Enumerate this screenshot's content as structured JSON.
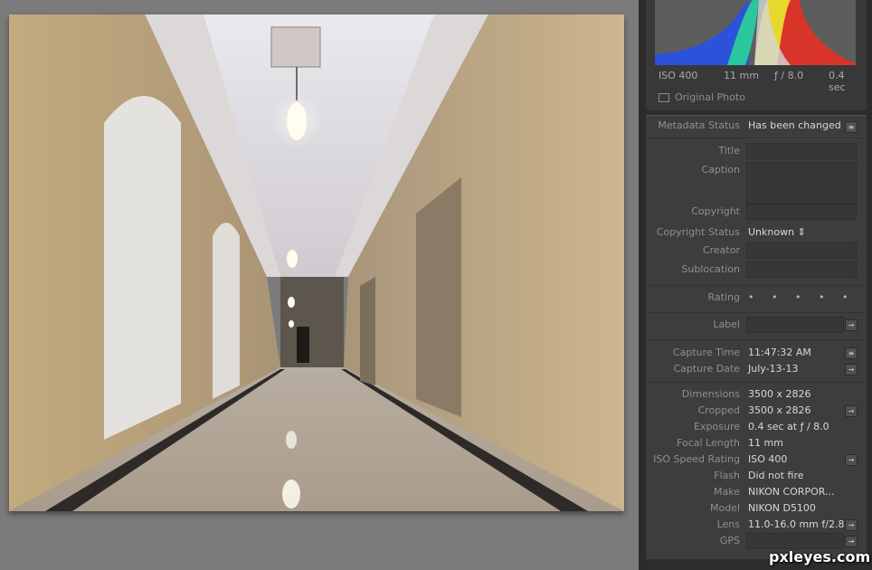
{
  "histogram": {
    "iso": "ISO 400",
    "focal": "11 mm",
    "aperture": "ƒ / 8.0",
    "shutter": "0.4 sec",
    "original_photo_label": "Original Photo"
  },
  "metadata": {
    "status_label": "Metadata Status",
    "status_value": "Has been changed",
    "title_label": "Title",
    "caption_label": "Caption",
    "copyright_label": "Copyright",
    "copyright_status_label": "Copyright Status",
    "copyright_status_value": "Unknown",
    "copyright_status_arrow": "⇕",
    "creator_label": "Creator",
    "sublocation_label": "Sublocation",
    "rating_label": "Rating",
    "rating_value": "• • • • •",
    "label_label": "Label",
    "capture_time_label": "Capture Time",
    "capture_time_value": "11:47:32 AM",
    "capture_date_label": "Capture Date",
    "capture_date_value": "July-13-13",
    "dimensions_label": "Dimensions",
    "dimensions_value": "3500 x 2826",
    "cropped_label": "Cropped",
    "cropped_value": "3500 x 2826",
    "exposure_label": "Exposure",
    "exposure_value": "0.4 sec at ƒ / 8.0",
    "focal_length_label": "Focal Length",
    "focal_length_value": "11 mm",
    "iso_label": "ISO Speed Rating",
    "iso_value": "ISO 400",
    "flash_label": "Flash",
    "flash_value": "Did not fire",
    "make_label": "Make",
    "make_value": "NIKON CORPOR...",
    "model_label": "Model",
    "model_value": "NIKON D5100",
    "lens_label": "Lens",
    "lens_value": "11.0-16.0 mm f/2.8",
    "gps_label": "GPS"
  },
  "icons": {
    "list": "≡",
    "go": "→"
  },
  "watermark": "pxleyes.com",
  "colors": {
    "panel_bg": "#3d3d3d",
    "canvas_bg": "#7b7b7b",
    "label": "#8f8f8f",
    "value": "#d8d8d8"
  }
}
